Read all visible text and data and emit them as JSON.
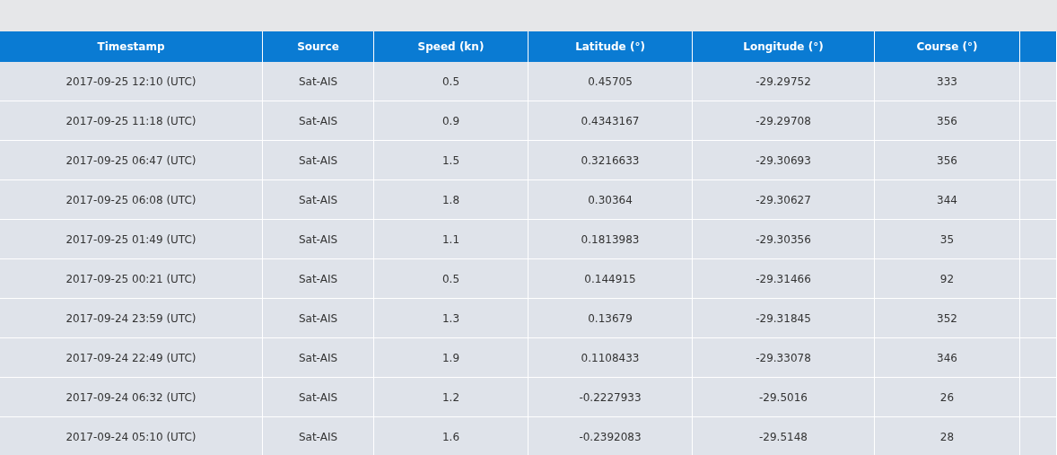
{
  "table": {
    "columns": [
      "Timestamp",
      "Source",
      "Speed (kn)",
      "Latitude (°)",
      "Longitude (°)",
      "Course (°)"
    ],
    "rows": [
      [
        "2017-09-25 12:10 (UTC)",
        "Sat-AIS",
        "0.5",
        "0.45705",
        "-29.29752",
        "333"
      ],
      [
        "2017-09-25 11:18 (UTC)",
        "Sat-AIS",
        "0.9",
        "0.4343167",
        "-29.29708",
        "356"
      ],
      [
        "2017-09-25 06:47 (UTC)",
        "Sat-AIS",
        "1.5",
        "0.3216633",
        "-29.30693",
        "356"
      ],
      [
        "2017-09-25 06:08 (UTC)",
        "Sat-AIS",
        "1.8",
        "0.30364",
        "-29.30627",
        "344"
      ],
      [
        "2017-09-25 01:49 (UTC)",
        "Sat-AIS",
        "1.1",
        "0.1813983",
        "-29.30356",
        "35"
      ],
      [
        "2017-09-25 00:21 (UTC)",
        "Sat-AIS",
        "0.5",
        "0.144915",
        "-29.31466",
        "92"
      ],
      [
        "2017-09-24 23:59 (UTC)",
        "Sat-AIS",
        "1.3",
        "0.13679",
        "-29.31845",
        "352"
      ],
      [
        "2017-09-24 22:49 (UTC)",
        "Sat-AIS",
        "1.9",
        "0.1108433",
        "-29.33078",
        "346"
      ],
      [
        "2017-09-24 06:32 (UTC)",
        "Sat-AIS",
        "1.2",
        "-0.2227933",
        "-29.5016",
        "26"
      ],
      [
        "2017-09-24 05:10 (UTC)",
        "Sat-AIS",
        "1.6",
        "-0.2392083",
        "-29.5148",
        "28"
      ]
    ]
  }
}
